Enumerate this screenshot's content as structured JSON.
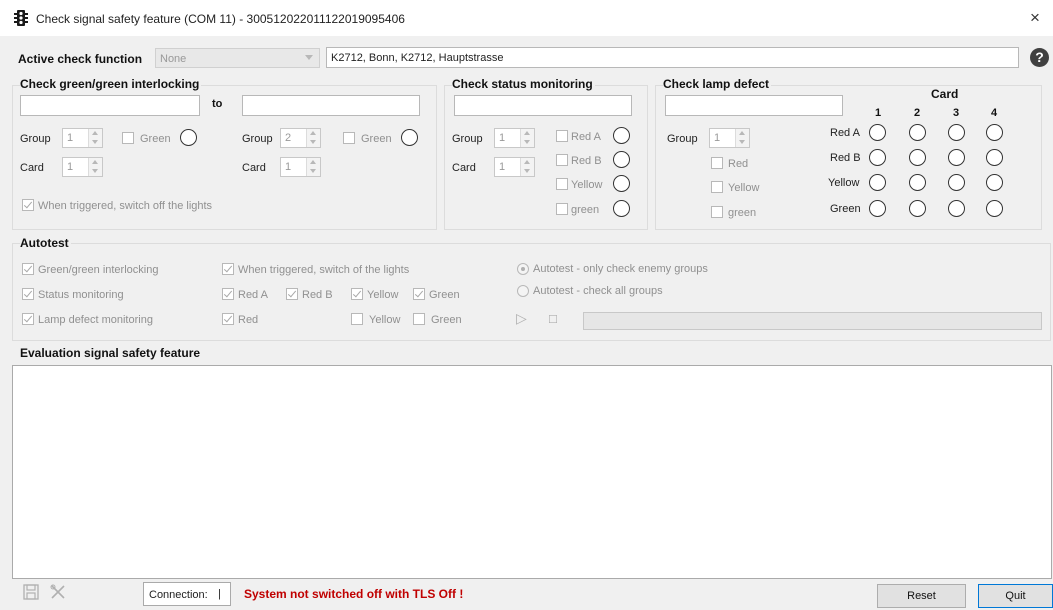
{
  "window": {
    "title": "Check signal safety feature (COM 11) - 300512022011122019095406",
    "icon": "traffic-light-icon",
    "close_glyph": "×"
  },
  "active_check": {
    "label": "Active check function",
    "combo_value": "None",
    "location": "K2712, Bonn, K2712, Hauptstrasse",
    "help_glyph": "?"
  },
  "interlock": {
    "title": "Check green/green interlocking",
    "to_label": "to",
    "left": {
      "group_label": "Group",
      "group_value": "1",
      "card_label": "Card",
      "card_value": "1",
      "green_label": "Green"
    },
    "right": {
      "group_label": "Group",
      "group_value": "2",
      "card_label": "Card",
      "card_value": "1",
      "green_label": "Green"
    },
    "switch_off_label": "When triggered, switch off the lights"
  },
  "status_monitoring": {
    "title": "Check status monitoring",
    "group_label": "Group",
    "group_value": "1",
    "card_label": "Card",
    "card_value": "1",
    "checks": [
      "Red A",
      "Red B",
      "Yellow",
      "green"
    ]
  },
  "lamp_defect": {
    "title": "Check lamp defect",
    "group_label": "Group",
    "group_value": "1",
    "checks": [
      "Red",
      "Yellow",
      "green"
    ],
    "card_title": "Card",
    "card_numbers": [
      "1",
      "2",
      "3",
      "4"
    ],
    "row_labels": [
      "Red A",
      "Red B",
      "Yellow",
      "Green"
    ]
  },
  "autotest": {
    "title": "Autotest",
    "col1": [
      "Green/green interlocking",
      "Status monitoring",
      "Lamp defect monitoring"
    ],
    "switch_label": "When triggered, switch of the lights",
    "row2": [
      "Red A",
      "Red B",
      "Yellow",
      "Green"
    ],
    "row3": [
      "Red",
      "Yellow",
      "Green"
    ],
    "radio_enemy": "Autotest - only check enemy groups",
    "radio_all": "Autotest - check all groups",
    "play_glyph": "▷",
    "stop_glyph": "□"
  },
  "evaluation": {
    "title": "Evaluation signal safety feature"
  },
  "status_bar": {
    "connection_label": "Connection:",
    "connection_value": "|",
    "message": "System not switched off with TLS Off !",
    "reset_label": "Reset",
    "quit_label": "Quit"
  },
  "icons": [
    "traffic-light-icon",
    "help-icon",
    "save-icon",
    "tools-icon",
    "close-icon",
    "play-icon",
    "stop-icon"
  ]
}
